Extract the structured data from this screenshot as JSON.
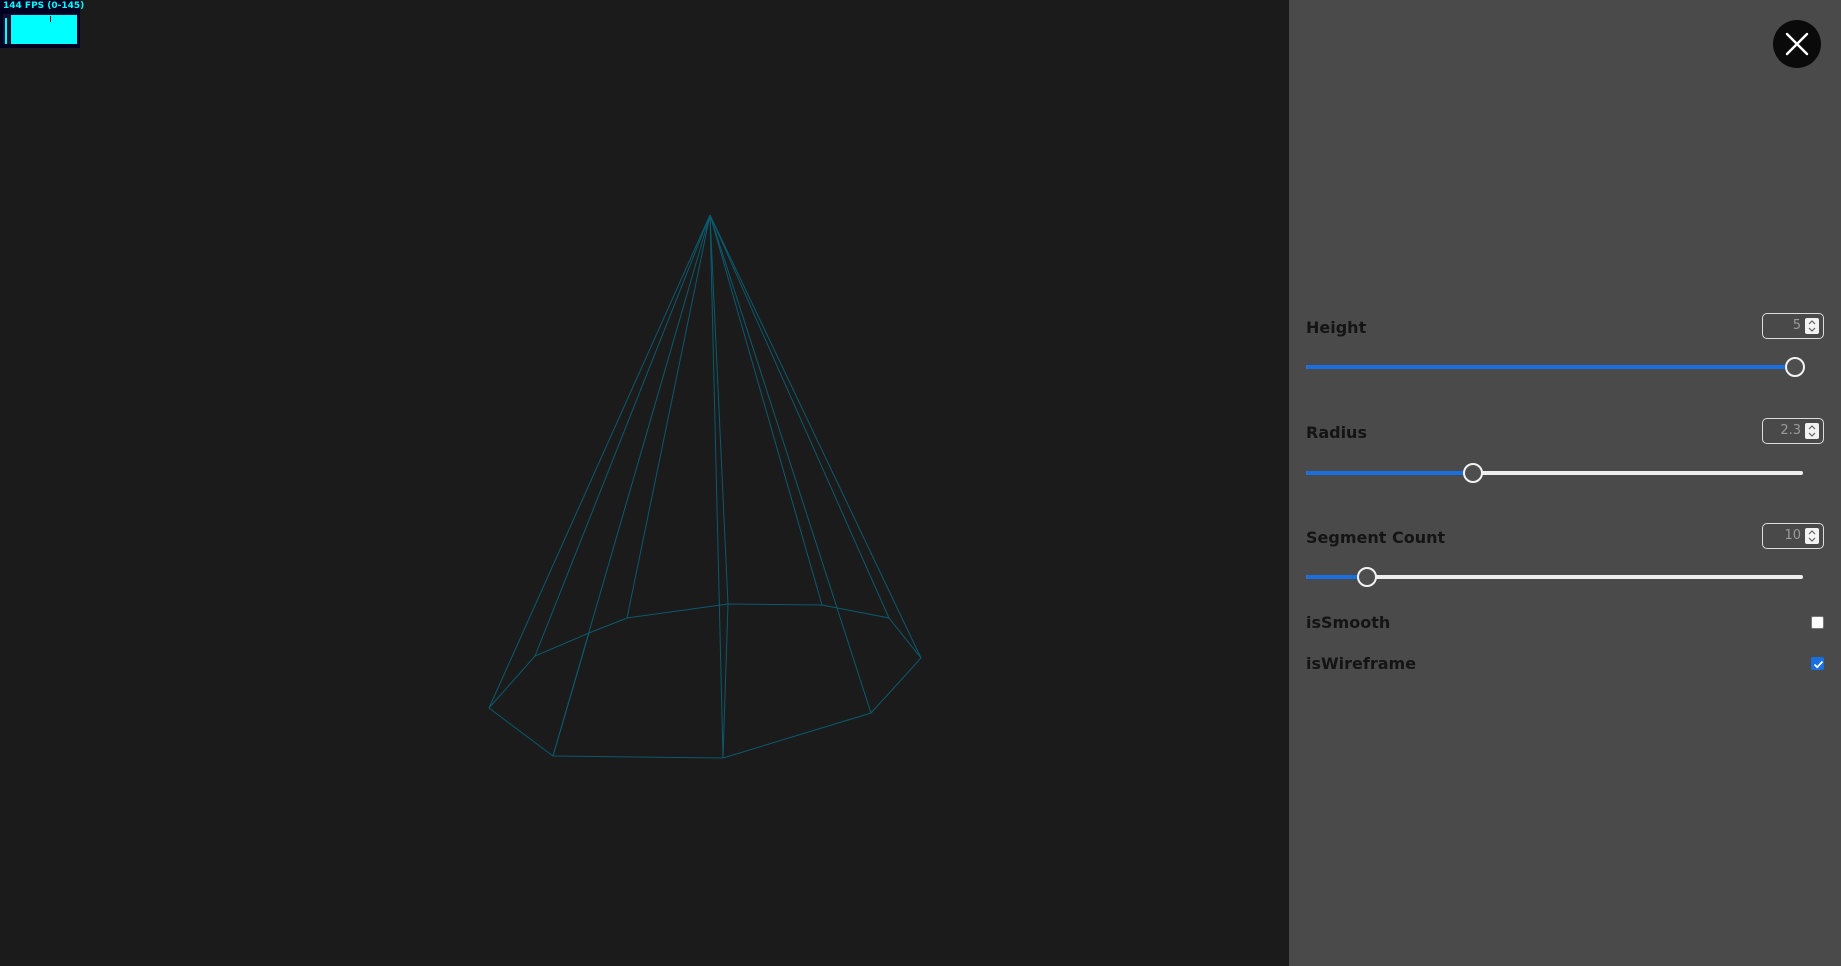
{
  "fps_monitor": {
    "text": "144 FPS (0-145)",
    "color": "#00ffff"
  },
  "scene": {
    "object": "cone",
    "wireframe_color": "#0b5a6e",
    "background": "#1b1b1b"
  },
  "panel": {
    "close_icon": "close-icon",
    "controls": {
      "height": {
        "label": "Height",
        "value": "5",
        "fill_fraction": 1.0
      },
      "radius": {
        "label": "Radius",
        "value": "2.3",
        "fill_fraction": 0.33
      },
      "segment_count": {
        "label": "Segment Count",
        "value": "10",
        "fill_fraction": 0.11
      },
      "is_smooth": {
        "label": "isSmooth",
        "checked": false
      },
      "is_wireframe": {
        "label": "isWireframe",
        "checked": true
      }
    },
    "accent_color": "#1a6fe0"
  }
}
